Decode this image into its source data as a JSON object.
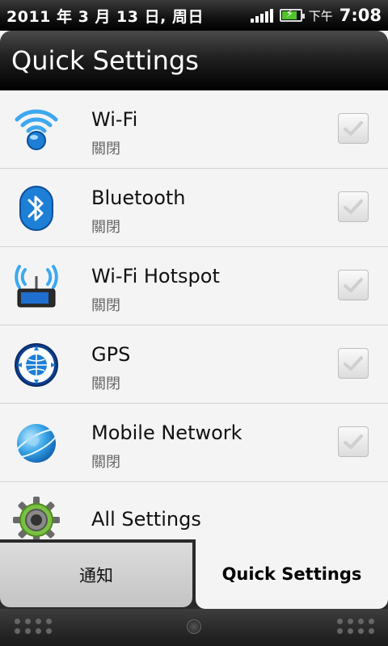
{
  "status_bar": {
    "date": "2011 年 3 月 13 日, 周日",
    "ampm": "下午",
    "time": "7:08"
  },
  "header": {
    "title": "Quick Settings"
  },
  "items": [
    {
      "label": "Wi-Fi",
      "status": "關閉",
      "icon": "wifi-icon",
      "checked": false
    },
    {
      "label": "Bluetooth",
      "status": "關閉",
      "icon": "bluetooth-icon",
      "checked": false
    },
    {
      "label": "Wi-Fi Hotspot",
      "status": "關閉",
      "icon": "hotspot-icon",
      "checked": false
    },
    {
      "label": "GPS",
      "status": "關閉",
      "icon": "gps-icon",
      "checked": false
    },
    {
      "label": "Mobile Network",
      "status": "關閉",
      "icon": "mobile-network-icon",
      "checked": false
    },
    {
      "label": "All Settings",
      "icon": "gear-icon"
    }
  ],
  "tabs": [
    {
      "label": "通知",
      "active": false
    },
    {
      "label": "Quick Settings",
      "active": true
    }
  ],
  "colors": {
    "accent_blue": "#1e7fd6",
    "battery_green": "#4fc22e",
    "gear_green": "#7ac143"
  }
}
